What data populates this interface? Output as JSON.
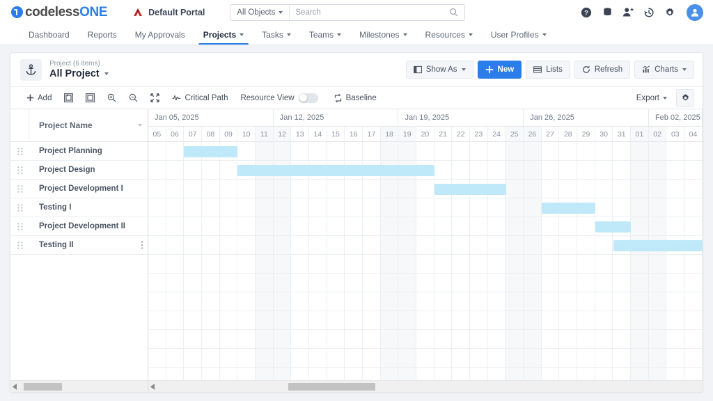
{
  "topbar": {
    "logo_a": "codeless",
    "logo_b": "ONE",
    "portal_label": "Default Portal",
    "object_selector": "All Objects",
    "search_placeholder": "Search",
    "search_value": "",
    "icons": [
      "help-icon",
      "database-icon",
      "add-user-icon",
      "history-icon",
      "gear-icon",
      "avatar"
    ]
  },
  "nav": {
    "tabs": [
      {
        "label": "Dashboard",
        "caret": false,
        "active": false
      },
      {
        "label": "Reports",
        "caret": false,
        "active": false
      },
      {
        "label": "My Approvals",
        "caret": false,
        "active": false
      },
      {
        "label": "Projects",
        "caret": true,
        "active": true
      },
      {
        "label": "Tasks",
        "caret": true,
        "active": false
      },
      {
        "label": "Teams",
        "caret": true,
        "active": false
      },
      {
        "label": "Milestones",
        "caret": true,
        "active": false
      },
      {
        "label": "Resources",
        "caret": true,
        "active": false
      },
      {
        "label": "User Profiles",
        "caret": true,
        "active": false
      }
    ]
  },
  "page": {
    "subtitle": "Project (6 items)",
    "title": "All Project",
    "actions": [
      {
        "label": "Show As",
        "icon": "panel-icon",
        "caret": true,
        "primary": false
      },
      {
        "label": "New",
        "icon": "plus-icon",
        "caret": false,
        "primary": true
      },
      {
        "label": "Lists",
        "icon": "list-icon",
        "caret": false,
        "primary": false
      },
      {
        "label": "Refresh",
        "icon": "refresh-icon",
        "caret": false,
        "primary": false
      },
      {
        "label": "Charts",
        "icon": "chart-icon",
        "caret": true,
        "primary": false
      }
    ]
  },
  "toolbar": {
    "add_label": "Add",
    "critical_path_label": "Critical Path",
    "resource_view_label": "Resource View",
    "resource_view_on": false,
    "baseline_label": "Baseline",
    "export_label": "Export",
    "icon_buttons": [
      "expand-all-icon",
      "collapse-all-icon",
      "zoom-in-icon",
      "zoom-out-icon",
      "fit-screen-icon"
    ],
    "settings_icon": "gear-icon"
  },
  "gantt": {
    "column_header": "Project Name",
    "weeks": [
      {
        "label": "Jan 05, 2025",
        "days": 7
      },
      {
        "label": "Jan 12, 2025",
        "days": 7
      },
      {
        "label": "Jan 19, 2025",
        "days": 7
      },
      {
        "label": "Jan 26, 2025",
        "days": 7
      },
      {
        "label": "Feb 02, 2025",
        "days": 3
      }
    ],
    "days": [
      {
        "label": "05",
        "weekend": false
      },
      {
        "label": "06",
        "weekend": false
      },
      {
        "label": "07",
        "weekend": false
      },
      {
        "label": "08",
        "weekend": false
      },
      {
        "label": "09",
        "weekend": false
      },
      {
        "label": "10",
        "weekend": false
      },
      {
        "label": "11",
        "weekend": true
      },
      {
        "label": "12",
        "weekend": true
      },
      {
        "label": "13",
        "weekend": false
      },
      {
        "label": "14",
        "weekend": false
      },
      {
        "label": "15",
        "weekend": false
      },
      {
        "label": "16",
        "weekend": false
      },
      {
        "label": "17",
        "weekend": false
      },
      {
        "label": "18",
        "weekend": true
      },
      {
        "label": "19",
        "weekend": true
      },
      {
        "label": "20",
        "weekend": false
      },
      {
        "label": "21",
        "weekend": false
      },
      {
        "label": "22",
        "weekend": false
      },
      {
        "label": "23",
        "weekend": false
      },
      {
        "label": "24",
        "weekend": false
      },
      {
        "label": "25",
        "weekend": true
      },
      {
        "label": "26",
        "weekend": true
      },
      {
        "label": "27",
        "weekend": false
      },
      {
        "label": "28",
        "weekend": false
      },
      {
        "label": "29",
        "weekend": false
      },
      {
        "label": "30",
        "weekend": false
      },
      {
        "label": "31",
        "weekend": false
      },
      {
        "label": "01",
        "weekend": true
      },
      {
        "label": "02",
        "weekend": true
      },
      {
        "label": "03",
        "weekend": false
      },
      {
        "label": "04",
        "weekend": false
      }
    ],
    "bar_color": "#bfe9f9",
    "tasks": [
      {
        "name": "Project Planning",
        "start_index": 2,
        "span": 3
      },
      {
        "name": "Project Design",
        "start_index": 5,
        "span": 11
      },
      {
        "name": "Project Development I",
        "start_index": 16,
        "span": 4
      },
      {
        "name": "Testing I",
        "start_index": 22,
        "span": 3
      },
      {
        "name": "Project Development II",
        "start_index": 25,
        "span": 2
      },
      {
        "name": "Testing II",
        "start_index": 26,
        "span": 5
      }
    ]
  },
  "scrollbars": {
    "left": {
      "thumb_start_pct": 3,
      "thumb_width_pct": 30
    },
    "right": {
      "thumb_start_pct": 24,
      "thumb_width_pct": 16
    }
  }
}
